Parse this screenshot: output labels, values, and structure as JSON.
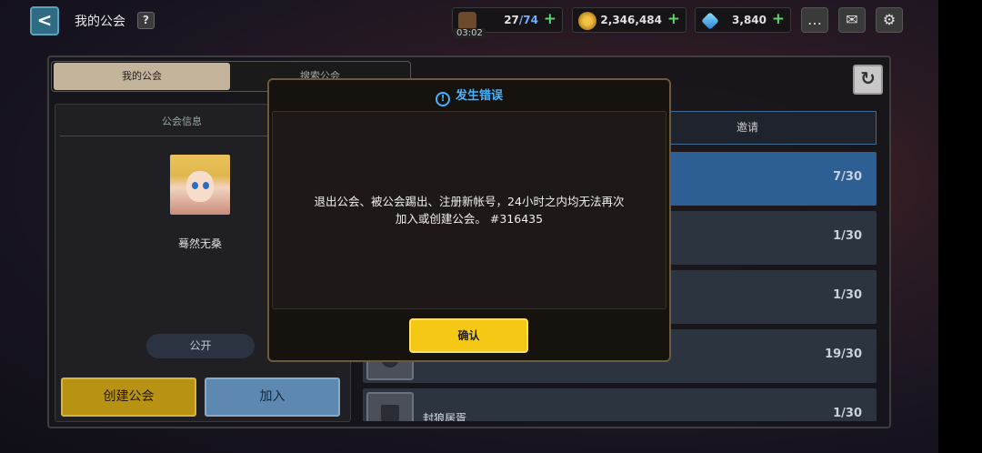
{
  "header": {
    "title": "我的公会",
    "help_label": "?",
    "back_label": "<"
  },
  "resources": {
    "stamina": {
      "current": "27",
      "max": "/74",
      "timer": "03:02"
    },
    "gold": {
      "value": "2,346,484"
    },
    "gems": {
      "value": "3,840"
    },
    "plus": "+"
  },
  "tabs": {
    "my_guild": "我的公会",
    "search_guild": "搜索公会"
  },
  "info_panel": {
    "header": "公会信息",
    "member_name": "蓦然无桑",
    "visibility": "公开"
  },
  "buttons": {
    "create": "创建公会",
    "join": "加入",
    "refresh": "↻"
  },
  "invite_tab": "邀请",
  "guilds": [
    {
      "name": "",
      "count": "7/30",
      "selected": true
    },
    {
      "name": "",
      "count": "1/30"
    },
    {
      "name": "",
      "count": "1/30"
    },
    {
      "name": "",
      "count": "19/30"
    },
    {
      "name": "封狼居胥",
      "count": "1/30"
    }
  ],
  "dialog": {
    "title": "发生错误",
    "icon": "!",
    "message_line1": "退出公会、被公会踢出、注册新帐号，24小时之内均无法再次",
    "message_line2": "加入或创建公会。 #316435",
    "confirm": "确认"
  },
  "colors": {
    "accent_blue": "#46b3ff",
    "confirm_yellow": "#f5c816",
    "create_gold": "#b89212",
    "join_blue": "#5d88b0"
  }
}
